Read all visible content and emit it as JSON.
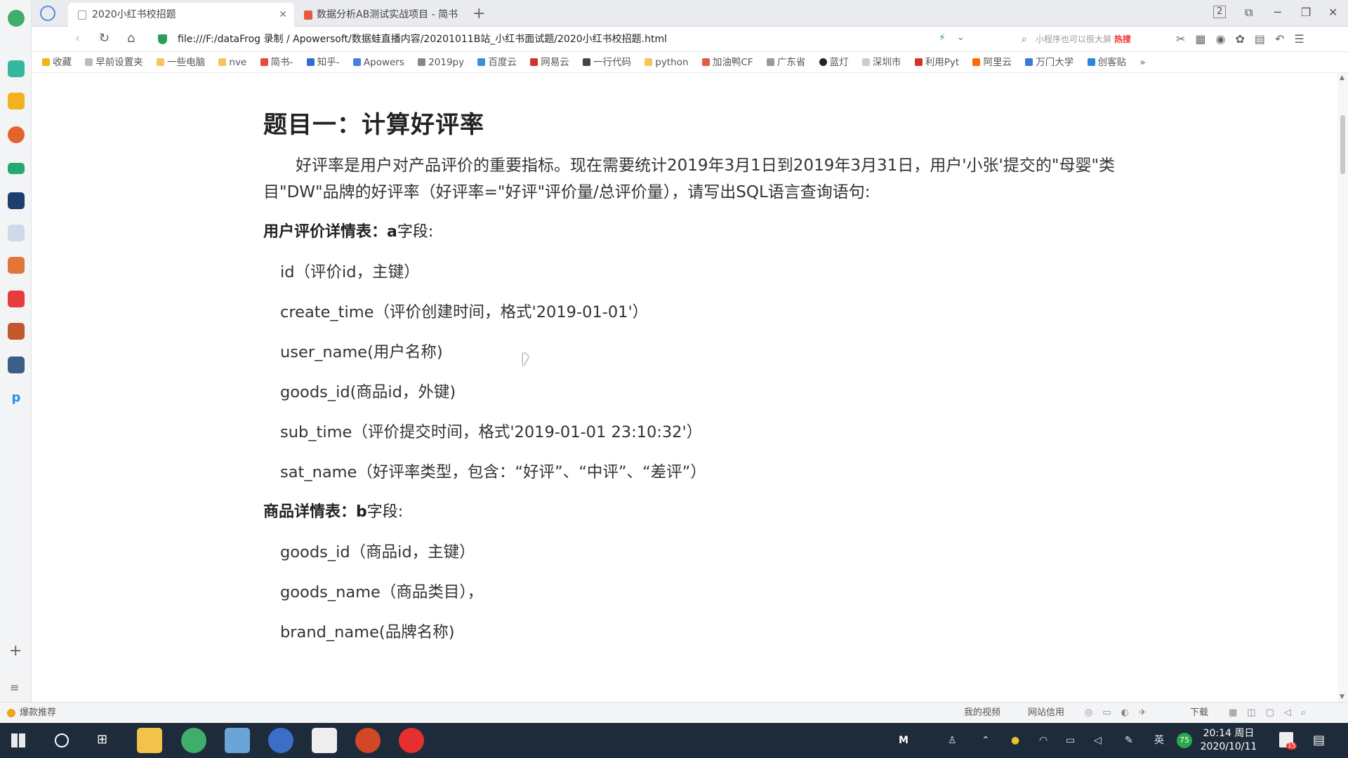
{
  "browser": {
    "tabs": [
      {
        "title": "2020小红书校招题",
        "active": true
      },
      {
        "title": "数据分析AB测试实战项目 - 简书",
        "active": false
      }
    ],
    "new_tab_label": "+",
    "tab_count_badge": "2",
    "url": "file:///F:/dataFrog 录制 / Apowersoft/数据蛙直播内容/20201011B站_小红书面试题/2020小红书校招题.html",
    "search_placeholder": "小程序也可以很大屏",
    "search_hot": "热搜",
    "bookmarks": [
      "收藏",
      "早前设置夹",
      "一些电脑",
      "nve",
      "简书-",
      "知乎-",
      "Apowers",
      "2019py",
      "百度云",
      "网易云",
      "一行代码",
      "python",
      "加油鸭CF",
      "广东省",
      "蓝灯",
      "深圳市",
      "利用Pyt",
      "阿里云",
      "万门大学",
      "创客贴"
    ],
    "bookmarks_more": "»"
  },
  "doc": {
    "title": "题目一：计算好评率",
    "intro": "好评率是用户对产品评价的重要指标。现在需要统计2019年3月1日到2019年3月31日，用户'小张'提交的\"母婴\"类目\"DW\"品牌的好评率（好评率=\"好评\"评价量/总评价量），请写出SQL语言查询语句:",
    "table_a": {
      "label": "用户评价详情表：a",
      "suffix": "字段:",
      "fields": [
        "id（评价id，主键）",
        "create_time（评价创建时间，格式'2019-01-01'）",
        "user_name(用户名称)",
        "goods_id(商品id，外键)",
        "sub_time（评价提交时间，格式'2019-01-01 23:10:32'）",
        "sat_name（好评率类型，包含：“好评”、“中评”、“差评”）"
      ]
    },
    "table_b": {
      "label": "商品详情表：b",
      "suffix": "字段:",
      "fields": [
        "goods_id（商品id，主键）",
        "goods_name（商品类目），",
        "brand_name(品牌名称)"
      ]
    }
  },
  "statusbar": {
    "left": "爆款推荐",
    "right_items": [
      "我的视频",
      "网站信用",
      "下载"
    ]
  },
  "taskbar": {
    "time": "20:14 周日",
    "date": "2020/10/11",
    "ime": "英",
    "battery_badge": "75",
    "notif_badge": "15"
  },
  "colors": {
    "accent_green": "#2a9d5b",
    "taskbar_bg": "#1e2b3a",
    "tab_bar": "#e9ebee"
  }
}
